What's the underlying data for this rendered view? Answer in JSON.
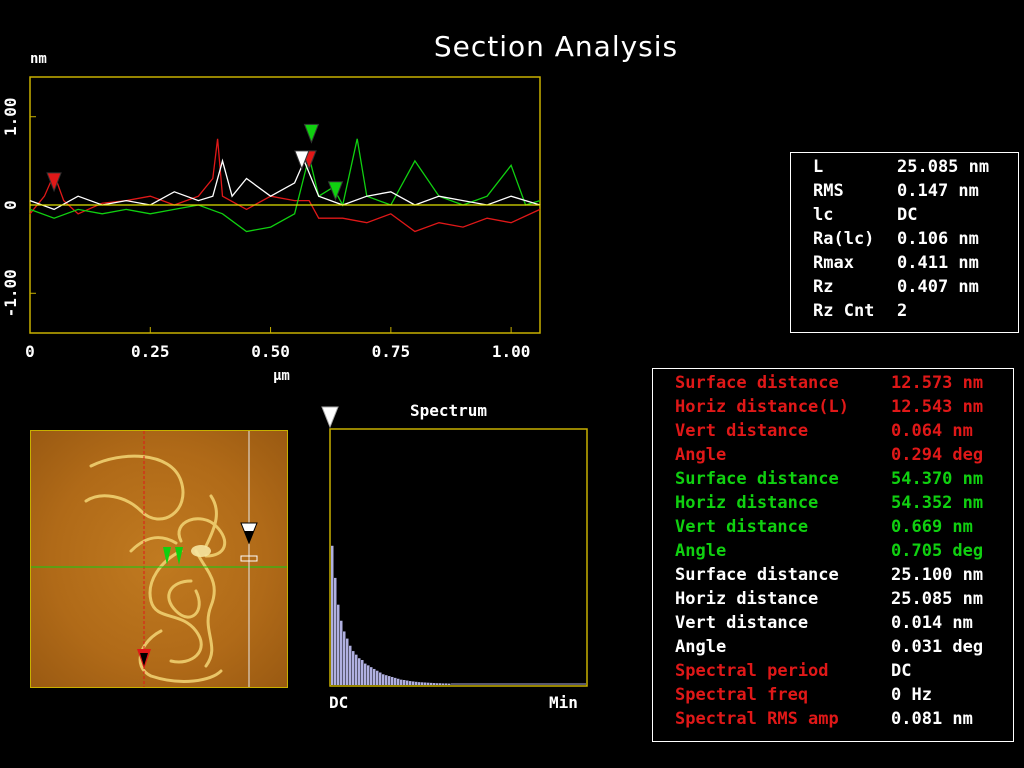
{
  "title": "Section Analysis",
  "profile": {
    "y_unit": "nm",
    "x_unit": "µm",
    "y_ticks": [
      "1.00",
      "0",
      "-1.00"
    ],
    "x_ticks": [
      "0",
      "0.25",
      "0.50",
      "0.75",
      "1.00"
    ]
  },
  "spectrum": {
    "title": "Spectrum",
    "left_label": "DC",
    "right_label": "Min"
  },
  "stats": [
    {
      "label": "L",
      "value": "25.085 nm"
    },
    {
      "label": "RMS",
      "value": "0.147 nm"
    },
    {
      "label": "lc",
      "value": "DC"
    },
    {
      "label": "Ra(lc)",
      "value": "0.106 nm"
    },
    {
      "label": "Rmax",
      "value": "0.411 nm"
    },
    {
      "label": "Rz",
      "value": "0.407 nm"
    },
    {
      "label": "Rz Cnt",
      "value": "2"
    }
  ],
  "measurements": [
    {
      "label": "Surface distance",
      "value": "12.573 nm",
      "color": "#e01818"
    },
    {
      "label": "Horiz distance(L)",
      "value": "12.543 nm",
      "color": "#e01818"
    },
    {
      "label": "Vert distance",
      "value": "0.064 nm",
      "color": "#e01818"
    },
    {
      "label": "Angle",
      "value": "0.294 deg",
      "color": "#e01818"
    },
    {
      "label": "Surface distance",
      "value": "54.370 nm",
      "color": "#10d010"
    },
    {
      "label": "Horiz distance",
      "value": "54.352 nm",
      "color": "#10d010"
    },
    {
      "label": "Vert distance",
      "value": "0.669 nm",
      "color": "#10d010"
    },
    {
      "label": "Angle",
      "value": "0.705 deg",
      "color": "#10d010"
    },
    {
      "label": "Surface distance",
      "value": "25.100 nm",
      "color": "#ffffff"
    },
    {
      "label": "Horiz distance",
      "value": "25.085 nm",
      "color": "#ffffff"
    },
    {
      "label": "Vert distance",
      "value": "0.014 nm",
      "color": "#ffffff"
    },
    {
      "label": "Angle",
      "value": "0.031 deg",
      "color": "#ffffff"
    },
    {
      "label": "Spectral period",
      "value": "DC",
      "color": "#e01818",
      "value_color": "#ffffff"
    },
    {
      "label": "Spectral freq",
      "value": "0 Hz",
      "color": "#e01818",
      "value_color": "#ffffff"
    },
    {
      "label": "Spectral RMS amp",
      "value": "0.081 nm",
      "color": "#e01818",
      "value_color": "#ffffff"
    }
  ],
  "chart_data": [
    {
      "type": "line",
      "xlabel": "µm",
      "ylabel": "nm",
      "xlim": [
        0,
        1.06
      ],
      "ylim": [
        -1.45,
        1.45
      ],
      "series": [
        {
          "color": "#e01818",
          "x": [
            0,
            0.03,
            0.05,
            0.07,
            0.1,
            0.15,
            0.2,
            0.25,
            0.3,
            0.35,
            0.38,
            0.39,
            0.4,
            0.45,
            0.5,
            0.55,
            0.58,
            0.6,
            0.65,
            0.7,
            0.75,
            0.8,
            0.85,
            0.9,
            0.95,
            1.0,
            1.06
          ],
          "y": [
            -0.1,
            0.1,
            0.35,
            0.05,
            -0.1,
            0.02,
            0.05,
            0.1,
            0.0,
            0.1,
            0.3,
            0.75,
            0.1,
            -0.05,
            0.1,
            0.05,
            0.05,
            -0.15,
            -0.15,
            -0.2,
            -0.1,
            -0.3,
            -0.2,
            -0.25,
            -0.15,
            -0.2,
            -0.05
          ]
        },
        {
          "color": "#10d010",
          "x": [
            0,
            0.05,
            0.1,
            0.15,
            0.2,
            0.25,
            0.3,
            0.35,
            0.4,
            0.45,
            0.5,
            0.55,
            0.58,
            0.6,
            0.63,
            0.65,
            0.68,
            0.7,
            0.75,
            0.8,
            0.85,
            0.9,
            0.95,
            1.0,
            1.03,
            1.06
          ],
          "y": [
            -0.05,
            -0.15,
            -0.05,
            -0.1,
            -0.05,
            -0.1,
            -0.05,
            0.0,
            -0.1,
            -0.3,
            -0.25,
            -0.1,
            0.55,
            0.1,
            0.2,
            0.0,
            0.75,
            0.1,
            0.0,
            0.5,
            0.1,
            0.0,
            0.1,
            0.45,
            0.0,
            0.05
          ]
        },
        {
          "color": "#ffffff",
          "x": [
            0,
            0.05,
            0.1,
            0.15,
            0.2,
            0.25,
            0.3,
            0.35,
            0.38,
            0.4,
            0.42,
            0.45,
            0.5,
            0.55,
            0.57,
            0.6,
            0.65,
            0.7,
            0.75,
            0.8,
            0.85,
            0.9,
            0.95,
            1.0,
            1.06
          ],
          "y": [
            0.05,
            -0.05,
            0.1,
            0.0,
            0.05,
            0.0,
            0.15,
            0.05,
            0.1,
            0.5,
            0.1,
            0.3,
            0.1,
            0.25,
            0.5,
            0.1,
            0.0,
            0.1,
            0.15,
            0.0,
            0.1,
            0.05,
            0.0,
            0.1,
            0.0
          ]
        },
        {
          "color": "#e0e000",
          "x": [
            0,
            1.06
          ],
          "y": [
            0.0,
            0.0
          ]
        }
      ],
      "markers": [
        {
          "color": "#e01818",
          "x": 0.05,
          "y": 0.25
        },
        {
          "color": "#e01818",
          "x": 0.58,
          "y": 0.5
        },
        {
          "color": "#10d010",
          "x": 0.585,
          "y": 0.8
        },
        {
          "color": "#10d010",
          "x": 0.635,
          "y": 0.15
        },
        {
          "color": "#ffffff",
          "x": 0.565,
          "y": 0.5
        }
      ]
    },
    {
      "type": "bar",
      "title": "Spectrum",
      "values": [
        0.78,
        0.6,
        0.45,
        0.36,
        0.3,
        0.26,
        0.22,
        0.19,
        0.17,
        0.15,
        0.14,
        0.12,
        0.11,
        0.1,
        0.09,
        0.08,
        0.07,
        0.06,
        0.055,
        0.05,
        0.045,
        0.04,
        0.035,
        0.03,
        0.028,
        0.025,
        0.022,
        0.02,
        0.018,
        0.016,
        0.015,
        0.014,
        0.013,
        0.012,
        0.011,
        0.01,
        0.01,
        0.009,
        0.009,
        0.008
      ],
      "ylim": [
        0,
        1
      ]
    }
  ]
}
